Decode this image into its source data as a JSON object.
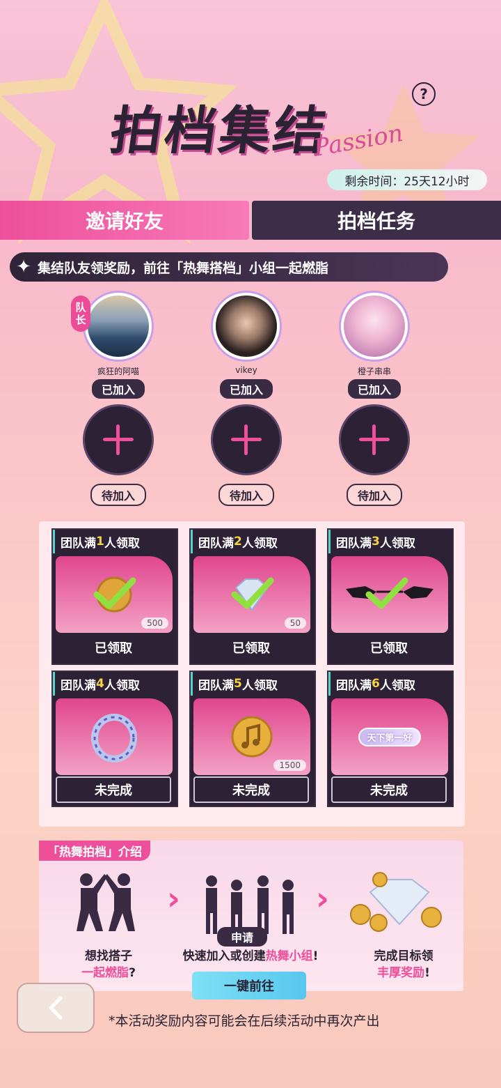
{
  "header": {
    "title": "拍档集结",
    "title_deco": "Passion",
    "help_icon": "?",
    "timer": "剩余时间：25天12小时"
  },
  "tabs": [
    {
      "label": "邀请好友",
      "active": true
    },
    {
      "label": "拍档任务",
      "active": false
    }
  ],
  "banner": "集结队友领奖励，前往「热舞搭档」小组一起燃脂",
  "members": [
    {
      "name": "疯狂的阿喵",
      "status": "已加入",
      "captain": "队长"
    },
    {
      "name": "vikey",
      "status": "已加入"
    },
    {
      "name": "橙子串串",
      "status": "已加入"
    }
  ],
  "pending": [
    "待加入",
    "待加入",
    "待加入"
  ],
  "rewards": [
    {
      "prefix": "团队满",
      "n": "1",
      "suffix": "人领取",
      "count": "500",
      "status": "已领取"
    },
    {
      "prefix": "团队满",
      "n": "2",
      "suffix": "人领取",
      "count": "50",
      "status": "已领取"
    },
    {
      "prefix": "团队满",
      "n": "3",
      "suffix": "人领取",
      "count": "",
      "status": "已领取"
    },
    {
      "prefix": "团队满",
      "n": "4",
      "suffix": "人领取",
      "count": "",
      "status": "未完成"
    },
    {
      "prefix": "团队满",
      "n": "5",
      "suffix": "人领取",
      "count": "1500",
      "status": "未完成"
    },
    {
      "prefix": "团队满",
      "n": "6",
      "suffix": "人领取",
      "count": "",
      "status": "未完成",
      "badge": "天下第一好"
    }
  ],
  "intro": {
    "tag": "「热舞拍档」介绍",
    "step1_a": "想找搭子",
    "step1_b": "一起燃脂",
    "step1_c": "?",
    "apply": "申请",
    "step2_a": "快速加入或创建",
    "step2_b": "热舞小组",
    "step2_c": "!",
    "step3_a": "完成目标领",
    "step3_b": "丰厚奖励",
    "step3_c": "!",
    "go": "一键前往"
  },
  "note": "*本活动奖励内容可能会在后续活动中再次产出",
  "colors": {
    "accent": "#ee4f9b",
    "dark": "#2d2235",
    "teal": "#58d4c9"
  }
}
